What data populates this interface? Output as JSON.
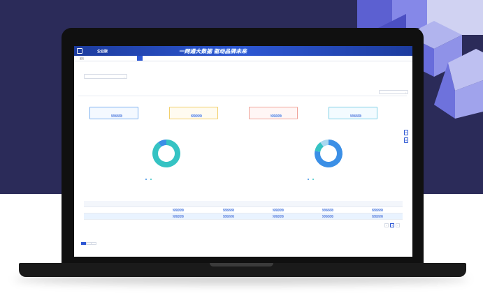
{
  "colors": {
    "accent": "#2d57d3",
    "header_bg": "#1d3c9e",
    "background_dark": "#2b2b59",
    "pie_teal": "#35c3c3",
    "pie_blue": "#3b8fe6",
    "pie_light": "#a8d8f0",
    "card_blue_border": "#7fb2f0",
    "card_yellow_border": "#f2cf6b",
    "card_red_border": "#f0a49a",
    "card_cyan_border": "#7fd0e6"
  },
  "header": {
    "brand": "",
    "edition": "企业版",
    "slogan": "一网通大数据 驱动品牌未来",
    "links": [
      "",
      "",
      ""
    ]
  },
  "nav": {
    "items": [
      "首页",
      "",
      "",
      "",
      "",
      "",
      "",
      "",
      "",
      "",
      ""
    ],
    "active_index": 10
  },
  "page": {
    "title": "",
    "description": "",
    "filter_label": "",
    "filter_value": ""
  },
  "tabs": {
    "items": [
      "",
      "",
      ""
    ],
    "active_index": 0,
    "date_value": ""
  },
  "section1": {
    "title": "",
    "cards": [
      {
        "label": "",
        "border": "#7fb2f0",
        "bg": "#f4f9ff"
      },
      {
        "label": "",
        "border": "#f2cf6b",
        "bg": "#fffbf0"
      },
      {
        "label": "",
        "border": "#f0a49a",
        "bg": "#fff6f5"
      },
      {
        "label": "",
        "border": "#7fd0e6",
        "bg": "#f3fbff"
      }
    ]
  },
  "pies": [
    {
      "title": "",
      "center_label": "",
      "slices": [
        0.9,
        0.1
      ],
      "slice_colors": [
        "#35c3c3",
        "#3b8fe6"
      ],
      "callout_top": "",
      "callout_bottom": "",
      "legend": [
        "",
        ""
      ]
    },
    {
      "title": "",
      "center_label": "",
      "slices": [
        0.78,
        0.12,
        0.1
      ],
      "slice_colors": [
        "#3b8fe6",
        "#35c3c3",
        "#a8d8f0"
      ],
      "callout_top": "",
      "callout_bottom": "",
      "legend": [
        "",
        ""
      ]
    }
  ],
  "table": {
    "headers": [
      "",
      "",
      "",
      "",
      "",
      ""
    ],
    "rows": [
      {
        "label": ""
      },
      {
        "label": ""
      }
    ]
  },
  "pager": {
    "prev": "‹",
    "current": "1",
    "next": "›"
  },
  "section2": {
    "title": "",
    "sub_tabs": [
      "",
      "",
      ""
    ],
    "active_index": 0
  },
  "side_icons": [
    "headset-icon",
    "document-icon"
  ]
}
